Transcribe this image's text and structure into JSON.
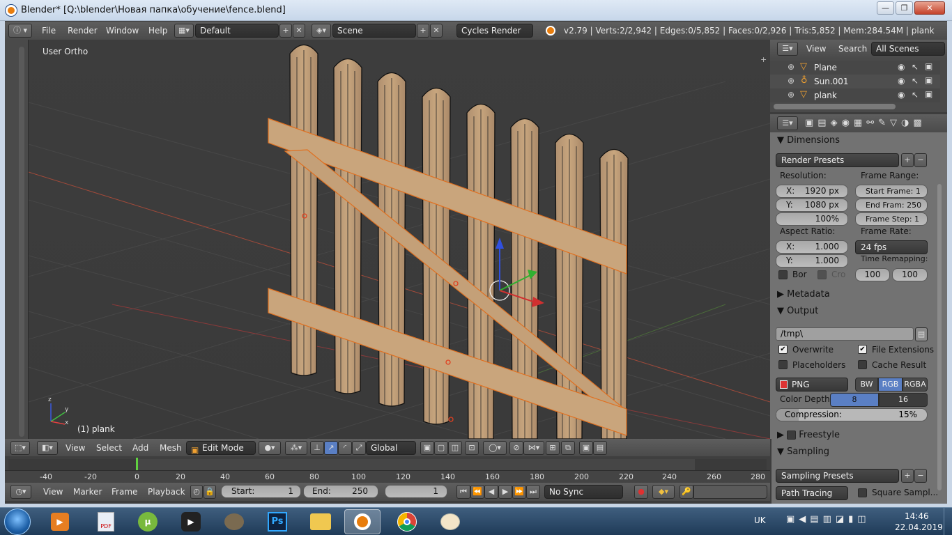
{
  "window": {
    "title": "Blender* [Q:\\blender\\Новая папка\\обучение\\fence.blend]",
    "min": "—",
    "max": "❐",
    "close": "✕"
  },
  "top_header": {
    "menus": [
      "File",
      "Render",
      "Window",
      "Help"
    ],
    "screen_layout": "Default",
    "scene": "Scene",
    "engine": "Cycles Render",
    "stats": "v2.79 | Verts:2/2,942 | Edges:0/5,852 | Faces:0/2,926 | Tris:5,852 | Mem:284.54M | plank"
  },
  "viewport": {
    "view_name": "User Ortho",
    "object_label": "(1) plank"
  },
  "outliner": {
    "tabs": [
      "View",
      "Search",
      "All Scenes"
    ],
    "items": [
      {
        "name": "Plane",
        "icon": "mesh-icon"
      },
      {
        "name": "Sun.001",
        "icon": "lamp-icon"
      },
      {
        "name": "plank",
        "icon": "mesh-icon"
      }
    ]
  },
  "properties": {
    "dimensions_title": "Dimensions",
    "render_presets": "Render Presets",
    "resolution_label": "Resolution:",
    "res_x": {
      "label": "X:",
      "value": "1920 px"
    },
    "res_y": {
      "label": "Y:",
      "value": "1080 px"
    },
    "res_pct": "100%",
    "frame_range_label": "Frame Range:",
    "start_frame": "Start Frame: 1",
    "end_frame": "End Fram: 250",
    "frame_step": "Frame Step: 1",
    "aspect_label": "Aspect Ratio:",
    "asp_x": {
      "label": "X:",
      "value": "1.000"
    },
    "asp_y": {
      "label": "Y:",
      "value": "1.000"
    },
    "frame_rate_label": "Frame Rate:",
    "frame_rate": "24 fps",
    "time_remap_label": "Time Remapping:",
    "remap_old": "100",
    "remap_new": "100",
    "border": "Bor",
    "crop": "Cro",
    "metadata_title": "Metadata",
    "output_title": "Output",
    "output_path": "/tmp\\",
    "overwrite": "Overwrite",
    "file_extensions": "File Extensions",
    "placeholders": "Placeholders",
    "cache_result": "Cache Result",
    "file_format": "PNG",
    "color_modes": [
      "BW",
      "RGB",
      "RGBA"
    ],
    "color_depth_label": "Color Depth:",
    "color_depths": [
      "8",
      "16"
    ],
    "compression_label": "Compression:",
    "compression_value": "15%",
    "compression_fraction": 0.15,
    "freestyle_title": "Freestyle",
    "sampling_title": "Sampling",
    "sampling_presets": "Sampling Presets",
    "integrator": "Path Tracing",
    "square_samples": "Square Sampl..."
  },
  "viewport_header": {
    "menus": [
      "View",
      "Select",
      "Add",
      "Mesh"
    ],
    "mode": "Edit Mode",
    "orientation": "Global"
  },
  "timeline": {
    "ticks": [
      "-40",
      "-20",
      "0",
      "20",
      "40",
      "60",
      "80",
      "100",
      "120",
      "140",
      "160",
      "180",
      "200",
      "220",
      "240",
      "260",
      "280"
    ],
    "menus": [
      "View",
      "Marker",
      "Frame",
      "Playback"
    ],
    "start": {
      "label": "Start:",
      "value": "1"
    },
    "end": {
      "label": "End:",
      "value": "250"
    },
    "current": "1",
    "sync": "No Sync"
  },
  "taskbar": {
    "lang": "UK",
    "time": "14:46",
    "date": "22.04.2019",
    "apps": [
      "media-player-icon",
      "pdf-icon",
      "utorrent-icon",
      "video-editor-icon",
      "gimp-icon",
      "photoshop-icon",
      "explorer-icon",
      "blender-icon",
      "chrome-icon",
      "paint-icon"
    ]
  }
}
